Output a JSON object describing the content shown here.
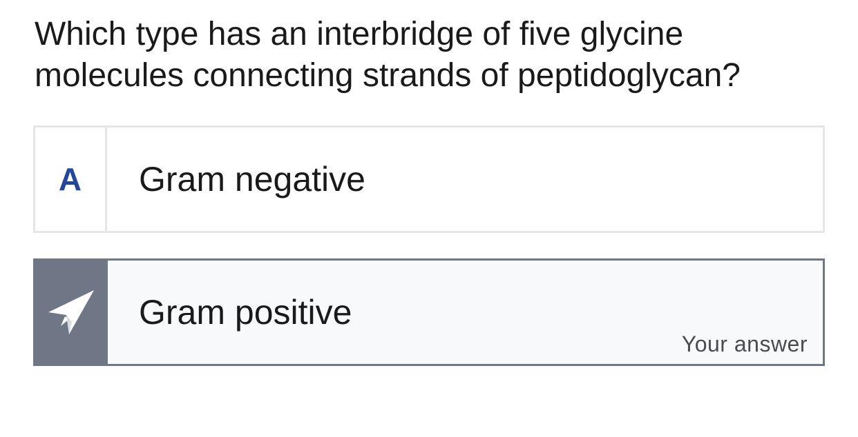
{
  "question": {
    "text": "Which type has an interbridge of five glycine molecules connecting strands of peptidoglycan?"
  },
  "options": [
    {
      "key": "A",
      "label": "Gram negative"
    },
    {
      "key_icon": "paper-plane-icon",
      "label": "Gram positive",
      "tag": "Your answer",
      "selected": true
    }
  ],
  "colors": {
    "selected_bg": "#6f7686",
    "key_letter": "#23479a",
    "border": "#e6e6e8"
  }
}
